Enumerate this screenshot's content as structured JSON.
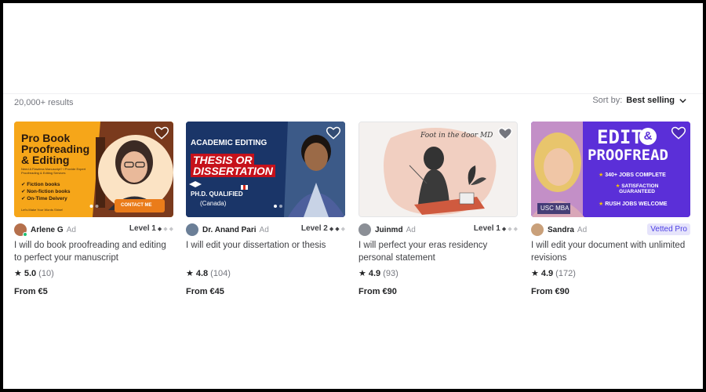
{
  "results_count": "20,000+ results",
  "sort": {
    "label": "Sort by:",
    "value": "Best selling"
  },
  "colors": {
    "vetted_bg": "#e6e4fb",
    "vetted_text": "#4c3fe4",
    "online": "#1dbf73"
  },
  "gigs": [
    {
      "thumb_text": {
        "headline1": "Pro Book",
        "headline2": "Proofreading",
        "headline3": "& Editing",
        "sub": "Need A Flawless Manuscript? I Provide Expert Proofreading & Editing Services",
        "b1": "✔ Fiction books",
        "b2": "✔ Non-fiction books",
        "b3": "✔ On-Time Deivery",
        "cta": "CONTACT ME",
        "footer": "Let's Make Your Words Shine!"
      },
      "seller": "Arlene G",
      "ad": "Ad",
      "level": "Level 1",
      "title": "I will do book proofreading and editing to perfect your manuscript",
      "rating": "5.0",
      "reviews": "(10)",
      "price": "From €5"
    },
    {
      "thumb_text": {
        "line1": "ACADEMIC EDITING",
        "line2": "THESIS OR",
        "line3": "DISSERTATION",
        "qual": "PH.D. QUALIFIED",
        "country": "(Canada)"
      },
      "seller": "Dr. Anand Pari",
      "ad": "Ad",
      "level": "Level 2",
      "title": "I will edit your dissertation or thesis",
      "rating": "4.8",
      "reviews": "(104)",
      "price": "From €45"
    },
    {
      "thumb_text": {
        "script": "Foot in the door MD"
      },
      "seller": "Juinmd",
      "ad": "Ad",
      "level": "Level 1",
      "title": "I will perfect your eras residency personal statement",
      "rating": "4.9",
      "reviews": "(93)",
      "price": "From €90"
    },
    {
      "thumb_text": {
        "w1": "EDIT",
        "amp": "&",
        "w2": "PROOFREAD",
        "p1": "340+ JOBS COMPLETE",
        "p2": "SATISFACTION GUARANTEED",
        "p3": "RUSH JOBS WELCOME",
        "tag": "USC MBA"
      },
      "seller": "Sandra",
      "ad": "Ad",
      "badge": "Vetted Pro",
      "title": "I will edit your document with unlimited revisions",
      "rating": "4.9",
      "reviews": "(172)",
      "price": "From €90"
    }
  ]
}
